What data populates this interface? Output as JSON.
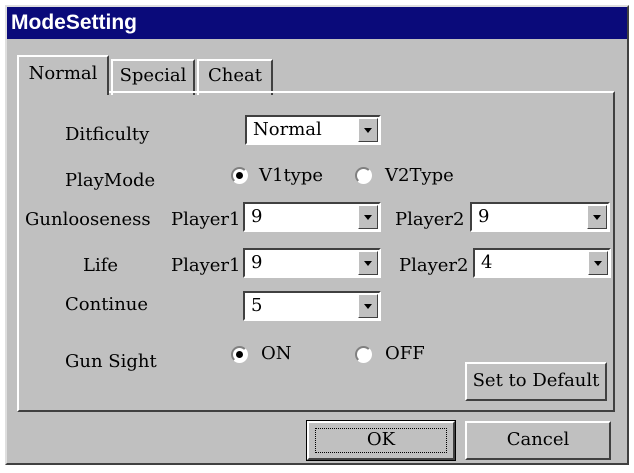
{
  "window": {
    "title": "ModeSetting"
  },
  "tabs": [
    {
      "label": "Normal",
      "active": true
    },
    {
      "label": "Special",
      "active": false
    },
    {
      "label": "Cheat",
      "active": false
    }
  ],
  "form": {
    "difficulty": {
      "label": "Ditficulty",
      "value": "Normal"
    },
    "playmode": {
      "label": "PlayMode",
      "options": [
        {
          "label": "V1type",
          "selected": true
        },
        {
          "label": "V2Type",
          "selected": false
        }
      ]
    },
    "gun_looseness": {
      "label": "Gunlooseness",
      "player1_label": "Player1",
      "player1_value": "9",
      "player2_label": "Player2",
      "player2_value": "9"
    },
    "life": {
      "label": "Life",
      "player1_label": "Player1",
      "player1_value": "9",
      "player2_label": "Player2",
      "player2_value": "4"
    },
    "continue": {
      "label": "Continue",
      "value": "5"
    },
    "gun_sight": {
      "label": "Gun Sight",
      "options": [
        {
          "label": "ON",
          "selected": true
        },
        {
          "label": "OFF",
          "selected": false
        }
      ]
    }
  },
  "buttons": {
    "set_default": "Set to Default",
    "ok": "OK",
    "cancel": "Cancel"
  },
  "colors": {
    "titlebar": "#0a0a7a",
    "face": "#c0c0c0"
  }
}
